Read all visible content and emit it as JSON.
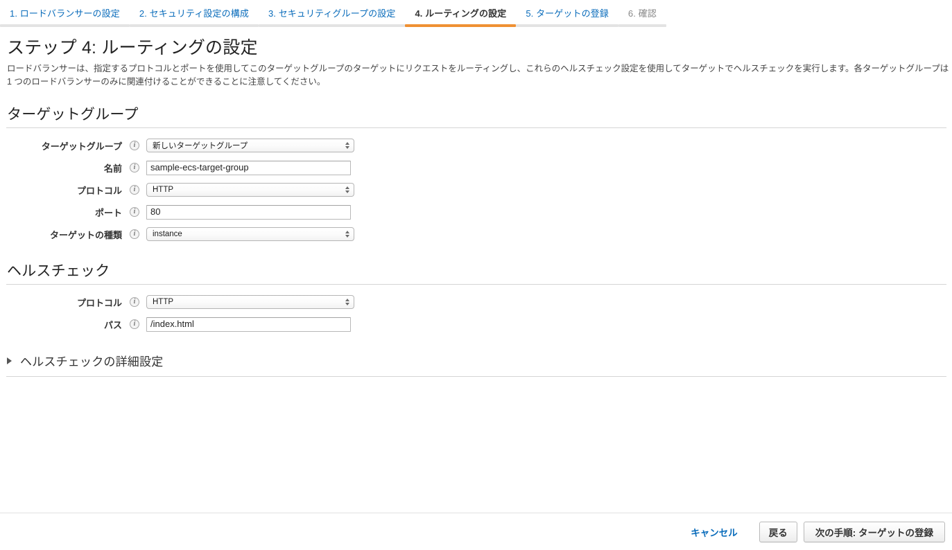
{
  "wizard": {
    "tabs": [
      {
        "label": "1. ロードバランサーの設定",
        "state": "done"
      },
      {
        "label": "2. セキュリティ設定の構成",
        "state": "done"
      },
      {
        "label": "3. セキュリティグループの設定",
        "state": "done"
      },
      {
        "label": "4. ルーティングの設定",
        "state": "active"
      },
      {
        "label": "5. ターゲットの登録",
        "state": "done"
      },
      {
        "label": "6. 確認",
        "state": "disabled"
      }
    ],
    "accent_color": "#ef9033",
    "link_color": "#0a6cbb"
  },
  "header": {
    "title": "ステップ 4: ルーティングの設定",
    "description": "ロードバランサーは、指定するプロトコルとポートを使用してこのターゲットグループのターゲットにリクエストをルーティングし、これらのヘルスチェック設定を使用してターゲットでヘルスチェックを実行します。各ターゲットグループは 1 つのロードバランサーのみに関連付けることができることに注意してください。"
  },
  "target_group_section": {
    "title": "ターゲットグループ",
    "fields": [
      {
        "label": "ターゲットグループ",
        "type": "select",
        "value": "新しいターゲットグループ",
        "icon": "info-icon"
      },
      {
        "label": "名前",
        "type": "text",
        "value": "sample-ecs-target-group",
        "icon": "info-icon"
      },
      {
        "label": "プロトコル",
        "type": "select",
        "value": "HTTP",
        "icon": "info-icon"
      },
      {
        "label": "ポート",
        "type": "text",
        "value": "80",
        "icon": "info-icon"
      },
      {
        "label": "ターゲットの種類",
        "type": "select",
        "value": "instance",
        "icon": "info-icon"
      }
    ]
  },
  "health_check_section": {
    "title": "ヘルスチェック",
    "fields": [
      {
        "label": "プロトコル",
        "type": "select",
        "value": "HTTP",
        "icon": "info-icon"
      },
      {
        "label": "パス",
        "type": "text",
        "value": "/index.html",
        "icon": "info-icon"
      }
    ]
  },
  "advanced": {
    "label": "ヘルスチェックの詳細設定",
    "expanded": false,
    "icon": "triangle-right-icon"
  },
  "footer": {
    "cancel_label": "キャンセル",
    "back_label": "戻る",
    "next_label": "次の手順: ターゲットの登録"
  }
}
